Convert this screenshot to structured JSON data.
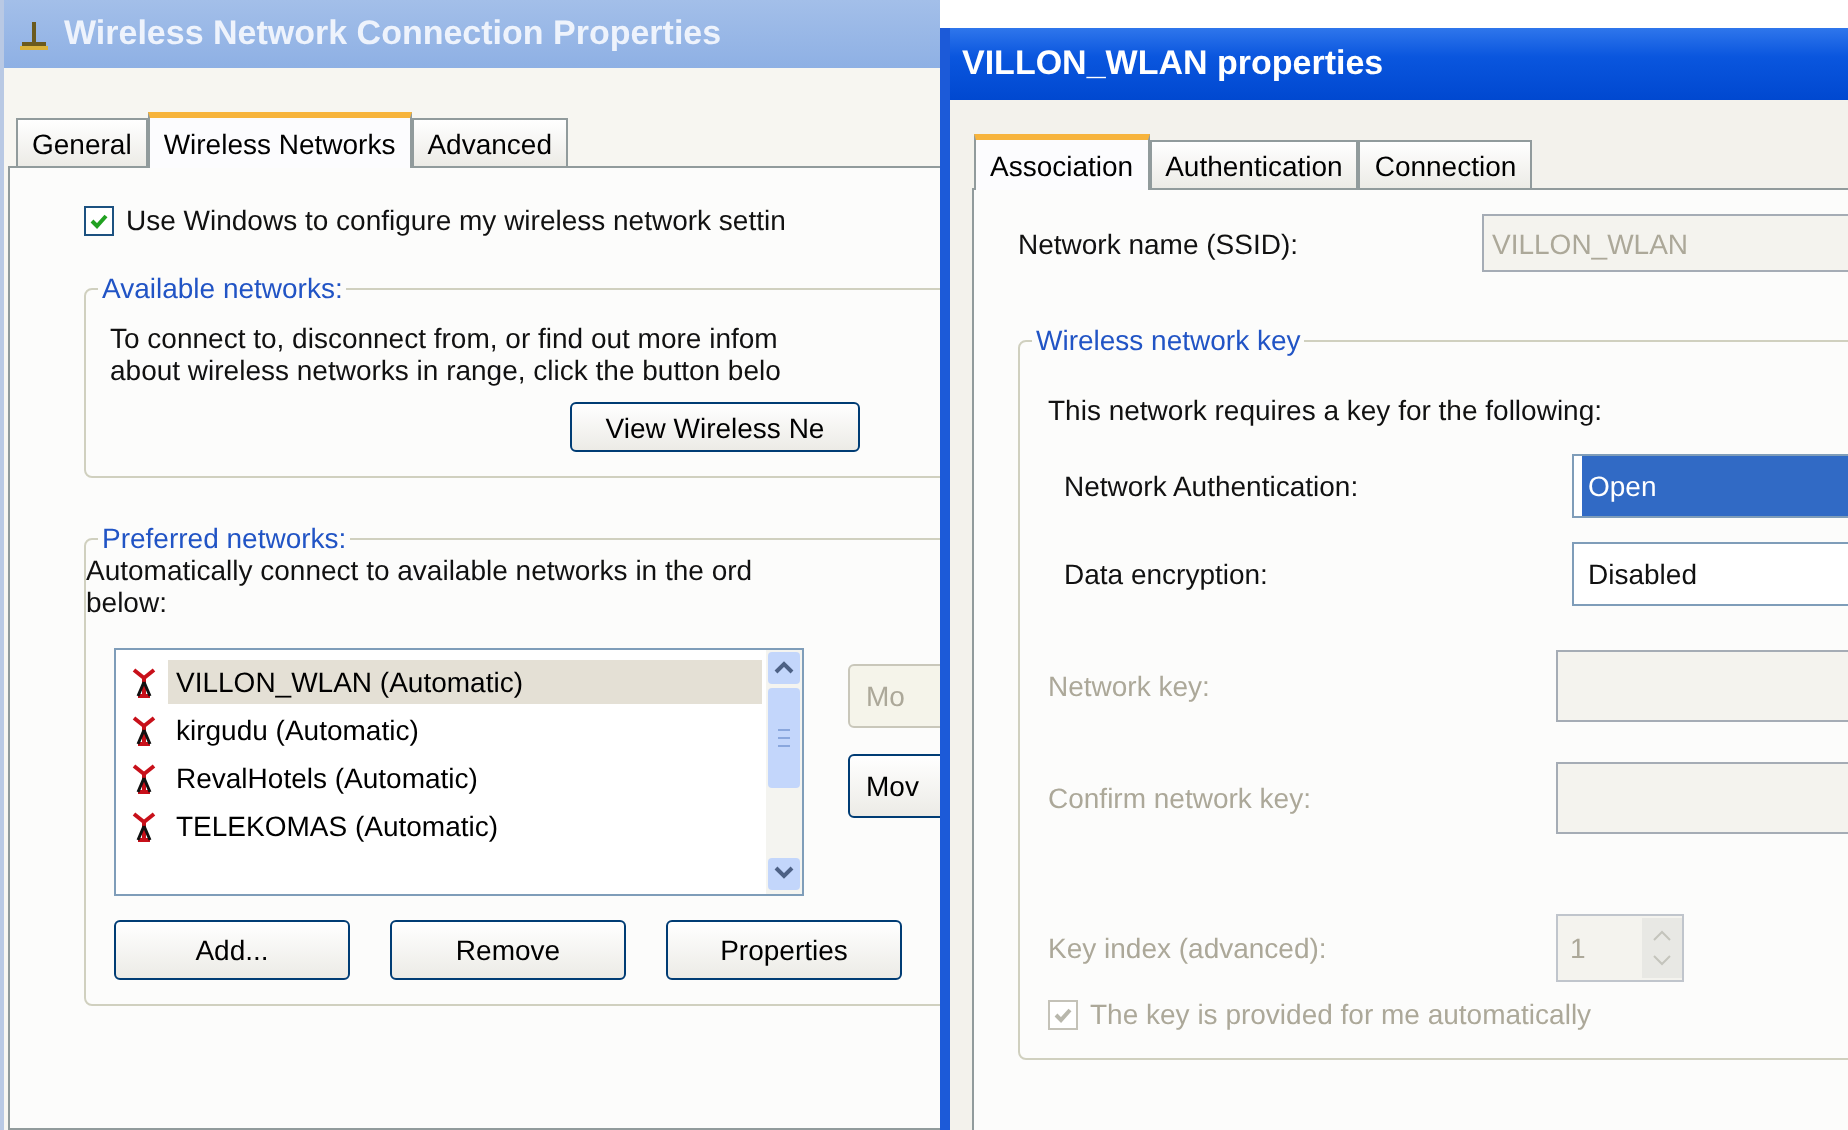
{
  "connection_window": {
    "title": "Wireless Network Connection Properties",
    "tabs": [
      {
        "label": "General",
        "selected": false
      },
      {
        "label": "Wireless Networks",
        "selected": true
      },
      {
        "label": "Advanced",
        "selected": false
      }
    ],
    "use_windows": {
      "label": "Use Windows to configure my wireless network settin",
      "checked": true
    },
    "available_networks": {
      "legend": "Available networks:",
      "description": [
        "To connect to, disconnect from, or find out more infom",
        "about wireless networks in range, click the button belo"
      ],
      "button": "View Wireless Ne"
    },
    "preferred_networks": {
      "legend": "Preferred networks:",
      "description": [
        "Automatically connect to available networks in the ord",
        "below:"
      ],
      "networks": [
        {
          "name": "VILLON_WLAN (Automatic)",
          "selected": true
        },
        {
          "name": "kirgudu (Automatic)",
          "selected": false
        },
        {
          "name": "RevalHotels (Automatic)",
          "selected": false
        },
        {
          "name": "TELEKOMAS (Automatic)",
          "selected": false
        }
      ],
      "move_buttons": [
        {
          "label": "Mo",
          "disabled": true
        },
        {
          "label": "Mov",
          "disabled": false
        }
      ],
      "buttons": [
        "Add...",
        "Remove",
        "Properties"
      ]
    }
  },
  "network_window": {
    "title": "VILLON_WLAN properties",
    "tabs": [
      {
        "label": "Association",
        "selected": true
      },
      {
        "label": "Authentication",
        "selected": false
      },
      {
        "label": "Connection",
        "selected": false
      }
    ],
    "ssid": {
      "label": "Network name (SSID):",
      "value": "VILLON_WLAN",
      "disabled": true
    },
    "key_group": {
      "legend": "Wireless network key",
      "intro": "This network requires a key for the following:",
      "fields": [
        {
          "kind": "select",
          "label": "Network Authentication:",
          "value": "Open",
          "disabled": false,
          "selected": true
        },
        {
          "kind": "select",
          "label": "Data encryption:",
          "value": "Disabled",
          "disabled": false,
          "selected": false
        },
        {
          "kind": "text",
          "label": "Network key:",
          "disabled": true
        },
        {
          "kind": "text",
          "label": "Confirm network key:",
          "disabled": true
        },
        {
          "kind": "spinner",
          "label": "Key index (advanced):",
          "value": "1",
          "disabled": true
        }
      ],
      "auto_key": {
        "label": "The key is provided for me automatically",
        "checked": true,
        "disabled": true
      }
    }
  }
}
